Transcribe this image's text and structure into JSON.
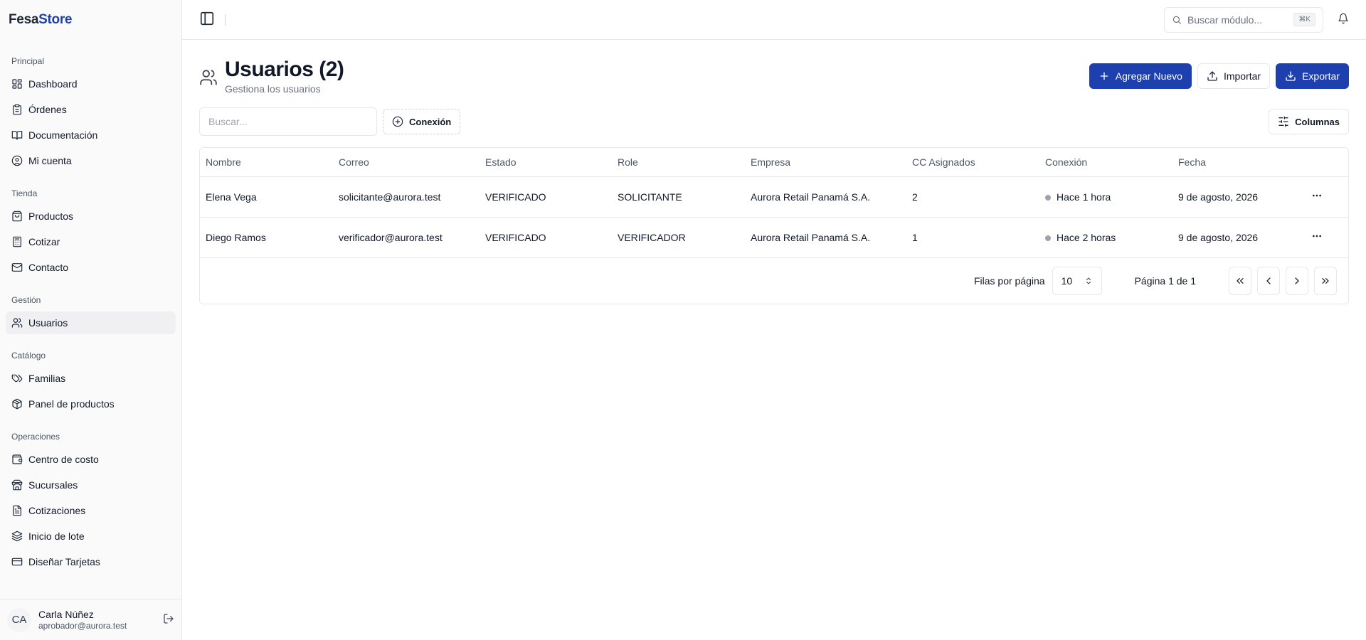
{
  "brand": {
    "part1": "Fesa",
    "part2": "Store"
  },
  "sidebar": {
    "groups": [
      {
        "label": "Principal",
        "items": [
          {
            "label": "Dashboard",
            "icon": "dashboard-icon"
          },
          {
            "label": "Órdenes",
            "icon": "clipboard-icon"
          },
          {
            "label": "Documentación",
            "icon": "book-open-icon"
          },
          {
            "label": "Mi cuenta",
            "icon": "user-circle-icon"
          }
        ]
      },
      {
        "label": "Tienda",
        "items": [
          {
            "label": "Productos",
            "icon": "shopping-bag-icon"
          },
          {
            "label": "Cotizar",
            "icon": "calculator-icon"
          },
          {
            "label": "Contacto",
            "icon": "mail-icon"
          }
        ]
      },
      {
        "label": "Gestión",
        "items": [
          {
            "label": "Usuarios",
            "icon": "users-icon",
            "active": true
          }
        ]
      },
      {
        "label": "Catálogo",
        "items": [
          {
            "label": "Familias",
            "icon": "tags-icon"
          },
          {
            "label": "Panel de productos",
            "icon": "package-icon"
          }
        ]
      },
      {
        "label": "Operaciones",
        "items": [
          {
            "label": "Centro de costo",
            "icon": "wallet-icon"
          },
          {
            "label": "Sucursales",
            "icon": "store-icon"
          },
          {
            "label": "Cotizaciones",
            "icon": "file-text-icon"
          },
          {
            "label": "Inicio de lote",
            "icon": "layers-icon"
          },
          {
            "label": "Diseñar Tarjetas",
            "icon": "credit-card-icon"
          }
        ]
      }
    ],
    "user": {
      "initials": "CA",
      "name": "Carla Núñez",
      "email": "aprobador@aurora.test"
    }
  },
  "topbar": {
    "search_placeholder": "Buscar módulo...",
    "shortcut": "⌘K"
  },
  "page": {
    "title": "Usuarios (2)",
    "subtitle": "Gestiona los usuarios",
    "add_label": "Agregar Nuevo",
    "import_label": "Importar",
    "export_label": "Exportar",
    "filter_placeholder": "Buscar...",
    "chip_label": "Conexión",
    "columns_label": "Columnas"
  },
  "table": {
    "headers": [
      "Nombre",
      "Correo",
      "Estado",
      "Role",
      "Empresa",
      "CC Asignados",
      "Conexión",
      "Fecha"
    ],
    "rows": [
      [
        "Elena Vega",
        "solicitante@aurora.test",
        "VERIFICADO",
        "SOLICITANTE",
        "Aurora Retail Panamá S.A.",
        "2",
        "Hace 1 hora",
        "9 de agosto, 2026"
      ],
      [
        "Diego Ramos",
        "verificador@aurora.test",
        "VERIFICADO",
        "VERIFICADOR",
        "Aurora Retail Panamá S.A.",
        "1",
        "Hace 2 horas",
        "9 de agosto, 2026"
      ]
    ]
  },
  "pagination": {
    "rows_label": "Filas por página",
    "rows_value": "10",
    "page_info": "Página 1 de 1"
  },
  "colors": {
    "primary": "#1e40af",
    "status_dot": "#9ca3af"
  }
}
